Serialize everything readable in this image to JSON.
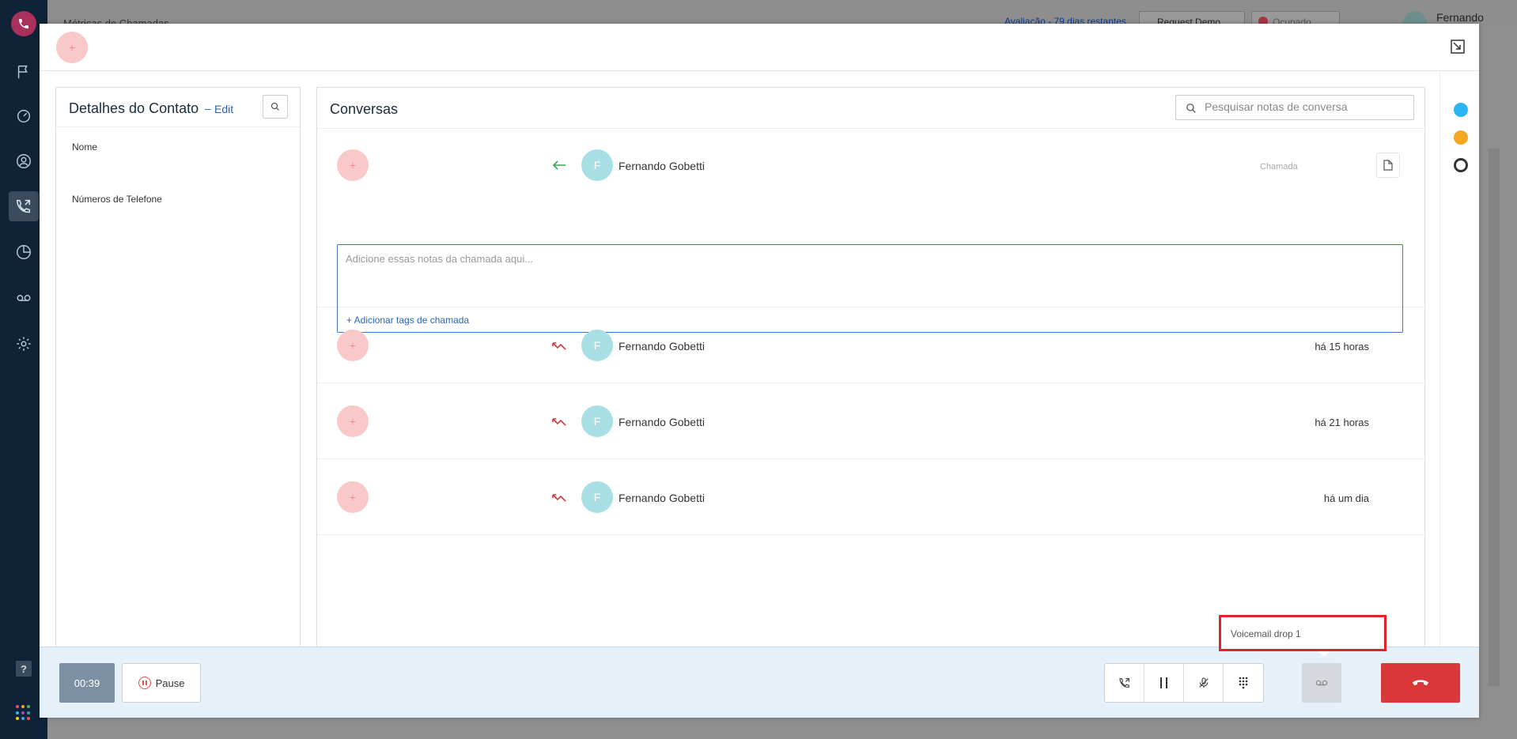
{
  "background_app": {
    "page_title": "Métricas de Chamadas",
    "trial_text": "Avaliação - 79 dias restantes",
    "request_demo_label": "Request Demo",
    "status_label": "Ocupado",
    "user_name": "Fernando Gobetti"
  },
  "rail": {
    "items": [
      "flag-icon",
      "dashboard-icon",
      "contacts-icon",
      "calls-icon",
      "reports-icon",
      "voicemail-icon",
      "settings-icon"
    ],
    "active": "calls-icon",
    "help_label": "?"
  },
  "modal": {
    "top_avatar_label": "+",
    "contact": {
      "title": "Detalhes do Contato",
      "separator": "–",
      "edit_label": "Edit",
      "name_label": "Nome",
      "phones_label": "Números de Telefone"
    },
    "conversations": {
      "title": "Conversas",
      "search_placeholder": "Pesquisar notas de conversa",
      "avatar_plus": "+",
      "rows": [
        {
          "name": "Fernando Gobetti",
          "initial": "F",
          "direction": "incoming",
          "type_label": "Chamada",
          "time": ""
        },
        {
          "name": "Fernando Gobetti",
          "initial": "F",
          "direction": "missed",
          "time": "há 15 horas"
        },
        {
          "name": "Fernando Gobetti",
          "initial": "F",
          "direction": "missed",
          "time": "há 21 horas"
        },
        {
          "name": "Fernando Gobetti",
          "initial": "F",
          "direction": "missed",
          "time": "há um dia"
        }
      ],
      "notes_placeholder": "Adicione essas notas da chamada aqui...",
      "add_tags_label": "+ Adicionar tags de chamada"
    }
  },
  "call_bar": {
    "timer": "00:39",
    "pause_label": "Pause",
    "voicemail_drop_label": "Voicemail drop 1"
  },
  "colors": {
    "rail_bg": "#0e2338",
    "accent_blue": "#2b64b5",
    "hangup_red": "#d9373a",
    "incoming_green": "#3aa655",
    "missed_red": "#d9373a"
  }
}
